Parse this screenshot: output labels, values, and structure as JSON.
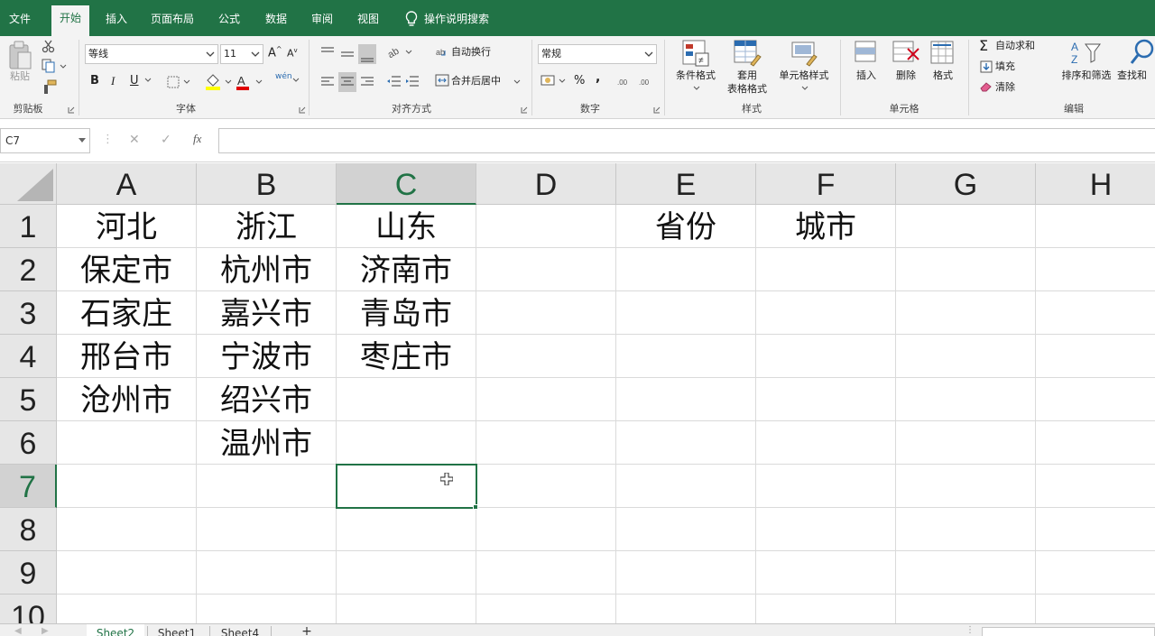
{
  "menu": {
    "items": [
      "文件",
      "开始",
      "插入",
      "页面布局",
      "公式",
      "数据",
      "审阅",
      "视图"
    ],
    "active_index": 1,
    "tell_me": "操作说明搜索"
  },
  "ribbon": {
    "clipboard": {
      "paste": "粘贴",
      "group": "剪贴板"
    },
    "font": {
      "name": "等线",
      "size": "11",
      "bold": "B",
      "italic": "I",
      "underline": "U",
      "grow": "A",
      "shrink": "A",
      "phonetic": "wén",
      "group": "字体"
    },
    "alignment": {
      "wrap": "自动换行",
      "merge": "合并后居中",
      "group": "对齐方式"
    },
    "number": {
      "format": "常规",
      "percent": "%",
      "comma": ",",
      "group": "数字"
    },
    "styles": {
      "conditional": "条件格式",
      "table_line1": "套用",
      "table_line2": "表格格式",
      "cell_styles": "单元格样式",
      "group": "样式"
    },
    "cells": {
      "insert": "插入",
      "delete": "删除",
      "format": "格式",
      "group": "单元格"
    },
    "editing": {
      "autosum": "自动求和",
      "fill": "填充",
      "clear": "清除",
      "sort": "排序和筛选",
      "find": "查找和",
      "group": "编辑"
    }
  },
  "formula_bar": {
    "name_box": "C7",
    "cancel": "✕",
    "enter": "✓",
    "fx": "fx",
    "content": ""
  },
  "sheet": {
    "columns": [
      "A",
      "B",
      "C",
      "D",
      "E",
      "F",
      "G",
      "H"
    ],
    "rows": [
      "1",
      "2",
      "3",
      "4",
      "5",
      "6",
      "7",
      "8",
      "9",
      "10"
    ],
    "selected_cell": "C7",
    "cells": {
      "A1": "河北",
      "B1": "浙江",
      "C1": "山东",
      "E1": "省份",
      "F1": "城市",
      "A2": "保定市",
      "B2": "杭州市",
      "C2": "济南市",
      "A3": "石家庄",
      "B3": "嘉兴市",
      "C3": "青岛市",
      "A4": "邢台市",
      "B4": "宁波市",
      "C4": "枣庄市",
      "A5": "沧州市",
      "B5": "绍兴市",
      "B6": "温州市"
    }
  },
  "tabs": {
    "items": [
      "Sheet2",
      "Sheet1",
      "Sheet4"
    ],
    "active_index": 0,
    "add": "+"
  },
  "colors": {
    "accent": "#217346",
    "ribbon_bg": "#f3f3f3",
    "header_bg": "#e6e6e6"
  }
}
